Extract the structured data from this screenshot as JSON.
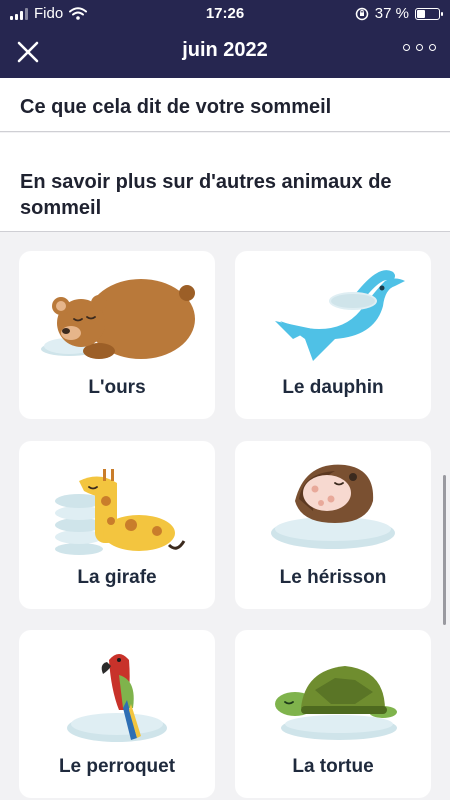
{
  "status_bar": {
    "carrier": "Fido",
    "time": "17:26",
    "battery": "37 %"
  },
  "nav": {
    "title": "juin 2022",
    "close_icon": "close-icon",
    "more_icon": "more-options-icon"
  },
  "sections": {
    "sleep_meaning": "Ce que cela dit de votre sommeil",
    "learn_more": "En savoir plus sur d'autres animaux de sommeil"
  },
  "animals": [
    {
      "label": "L'ours",
      "icon": "bear-illustration"
    },
    {
      "label": "Le dauphin",
      "icon": "dolphin-illustration"
    },
    {
      "label": "La girafe",
      "icon": "giraffe-illustration"
    },
    {
      "label": "Le hérisson",
      "icon": "hedgehog-illustration"
    },
    {
      "label": "Le perroquet",
      "icon": "parrot-illustration"
    },
    {
      "label": "La tortue",
      "icon": "turtle-illustration"
    }
  ]
}
